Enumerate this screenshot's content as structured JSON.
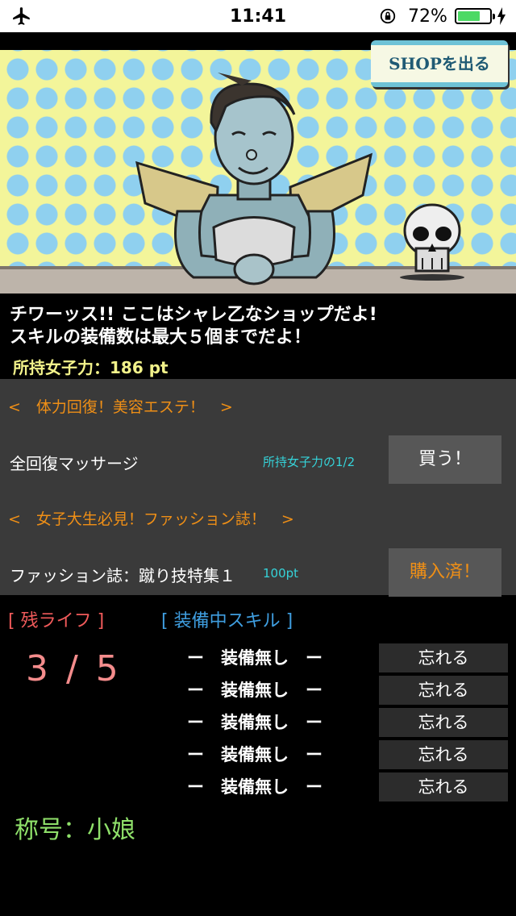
{
  "status_bar": {
    "time": "11:41",
    "battery_percent": "72%",
    "battery_level": 0.72,
    "icons": [
      "airplane-icon",
      "orientation-lock-icon",
      "battery-icon",
      "charging-bolt-icon"
    ]
  },
  "shop": {
    "exit_button": "SHOPを出る",
    "message_line1": "チワーッス!! ここはシャレ乙なショップだよ!",
    "message_line2": "スキルの装備数は最大５個までだよ！",
    "points": "所持女子力：186 pt",
    "categories": [
      {
        "header": "<　体力回復！美容エステ！　>",
        "item_name": "全回復マッサージ",
        "item_price": "所持女子力の1/2",
        "button": "買う！"
      },
      {
        "header": "<　女子大生必見！ファッション誌！　>",
        "item_name": "ファッション誌：蹴り技特集１",
        "item_price": "100pt",
        "button": "購入済！"
      }
    ]
  },
  "status": {
    "life_label": "[ 残ライフ ]",
    "life_value": "3 / 5",
    "skill_label": "[ 装備中スキル ]",
    "skills": [
      {
        "name": "ー　装備無し　ー",
        "button": "忘れる"
      },
      {
        "name": "ー　装備無し　ー",
        "button": "忘れる"
      },
      {
        "name": "ー　装備無し　ー",
        "button": "忘れる"
      },
      {
        "name": "ー　装備無し　ー",
        "button": "忘れる"
      },
      {
        "name": "ー　装備無し　ー",
        "button": "忘れる"
      }
    ],
    "title": "称号：小娘"
  },
  "colors": {
    "accent_orange": "#ef8f16",
    "price_cyan": "#35d3d9",
    "life_red": "#f05a5a",
    "skill_blue": "#3f9ee0",
    "title_green": "#8fe06a"
  }
}
